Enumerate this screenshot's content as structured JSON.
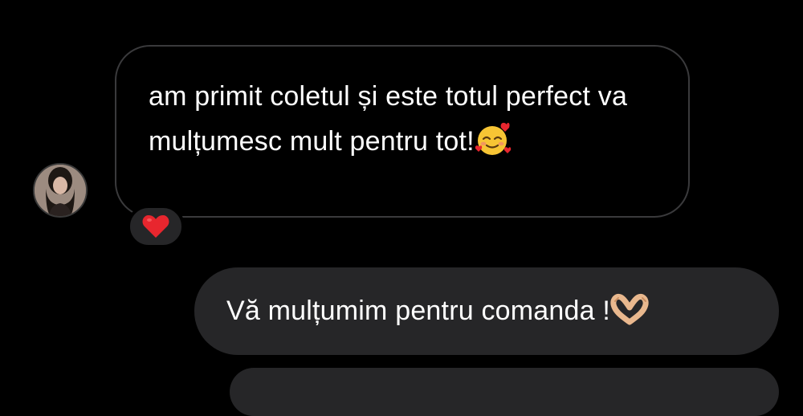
{
  "conversation": {
    "incoming": {
      "text_parts": [
        "am primit coletul și este totul ",
        "perfect va mulțumesc mult pentru ",
        "tot!"
      ],
      "emoji_icon": "smiling-face-with-hearts-icon",
      "reaction_icon": "red-heart-icon"
    },
    "outgoing": {
      "text": "Vă mulțumim pentru comanda ! ",
      "emoji_icon": "heart-hands-icon"
    }
  },
  "colors": {
    "background": "#000000",
    "incoming_border": "#3a3a3c",
    "outgoing_bubble": "#262628",
    "text": "#ffffff",
    "heart": "#e8262e"
  }
}
